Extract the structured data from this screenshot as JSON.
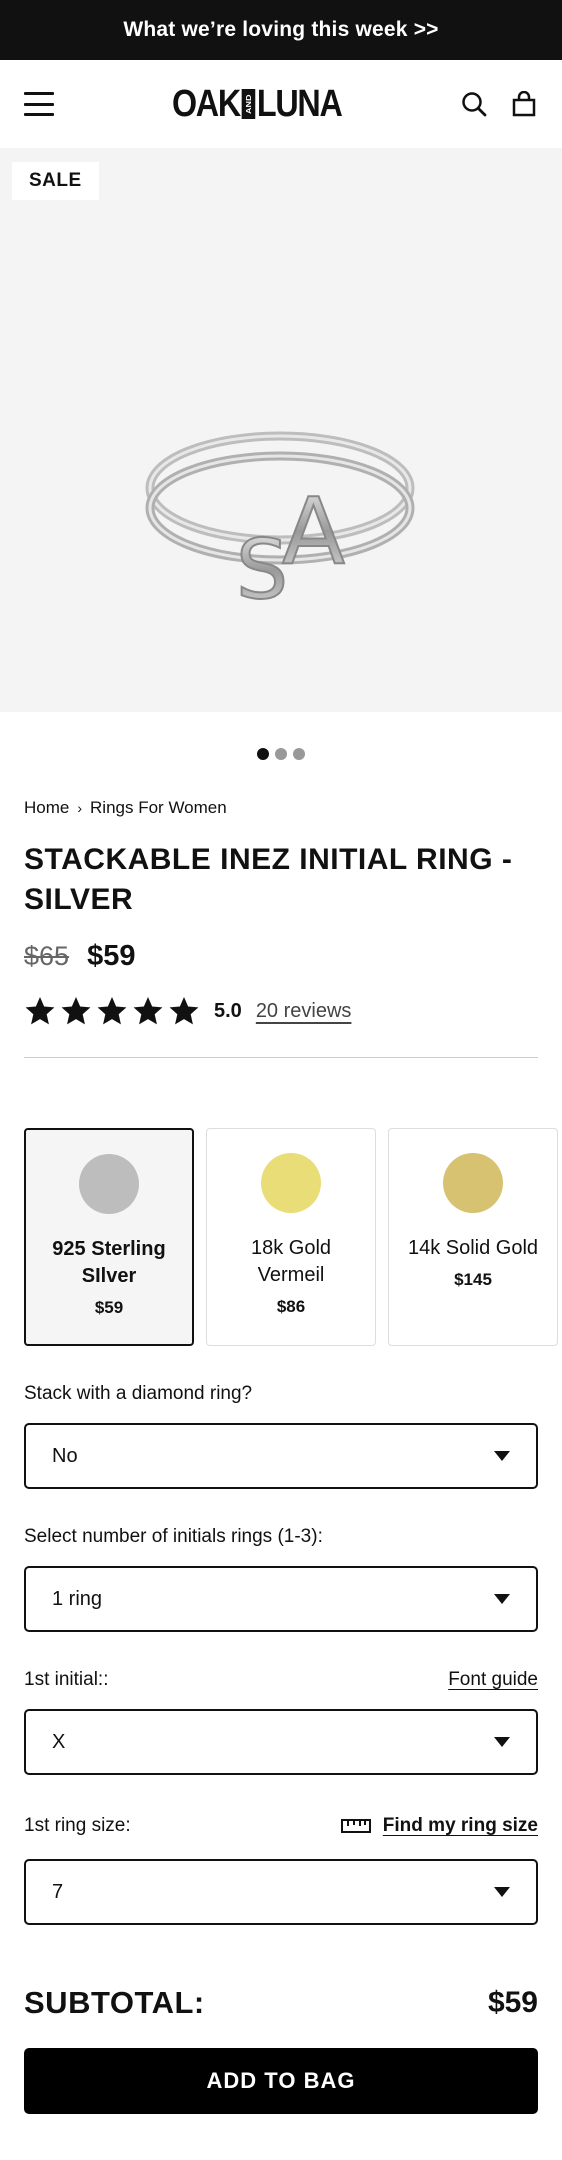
{
  "announcement": {
    "text": "What we’re loving this week >>"
  },
  "header": {
    "logo_left": "OAK",
    "logo_mid": "AND",
    "logo_right": "LUNA",
    "icons": [
      "menu-icon",
      "search-icon",
      "bag-icon"
    ]
  },
  "gallery": {
    "badge": "SALE",
    "image_letters": [
      "S",
      "A"
    ],
    "dots_count": 3,
    "active_dot": 1
  },
  "breadcrumb": {
    "home": "Home",
    "current": "Rings For Women"
  },
  "product": {
    "title": "STACKABLE INEZ INITIAL RING - SILVER",
    "price_original": "$65",
    "price_sale": "$59",
    "rating": "5.0",
    "stars": 5,
    "reviews_label": "20 reviews"
  },
  "variants": [
    {
      "name": "925 Sterling SIlver",
      "price": "$59",
      "color": "#bdbdbd",
      "selected": true
    },
    {
      "name": "18k Gold Vermeil",
      "price": "$86",
      "color": "#e9dd78",
      "selected": false
    },
    {
      "name": "14k Solid Gold",
      "price": "$145",
      "color": "#d6c271",
      "selected": false
    }
  ],
  "options": {
    "diamond_label": "Stack with a diamond ring?",
    "diamond_value": "No",
    "count_label": "Select number of initials rings (1-3):",
    "count_value": "1 ring",
    "initial_label": "1st initial::",
    "initial_link": "Font guide",
    "initial_value": "X",
    "size_label": "1st ring size:",
    "size_link": "Find my ring size",
    "size_value": "7"
  },
  "subtotal": {
    "label": "SUBTOTAL:",
    "value": "$59"
  },
  "cta": {
    "label": "ADD TO BAG"
  }
}
